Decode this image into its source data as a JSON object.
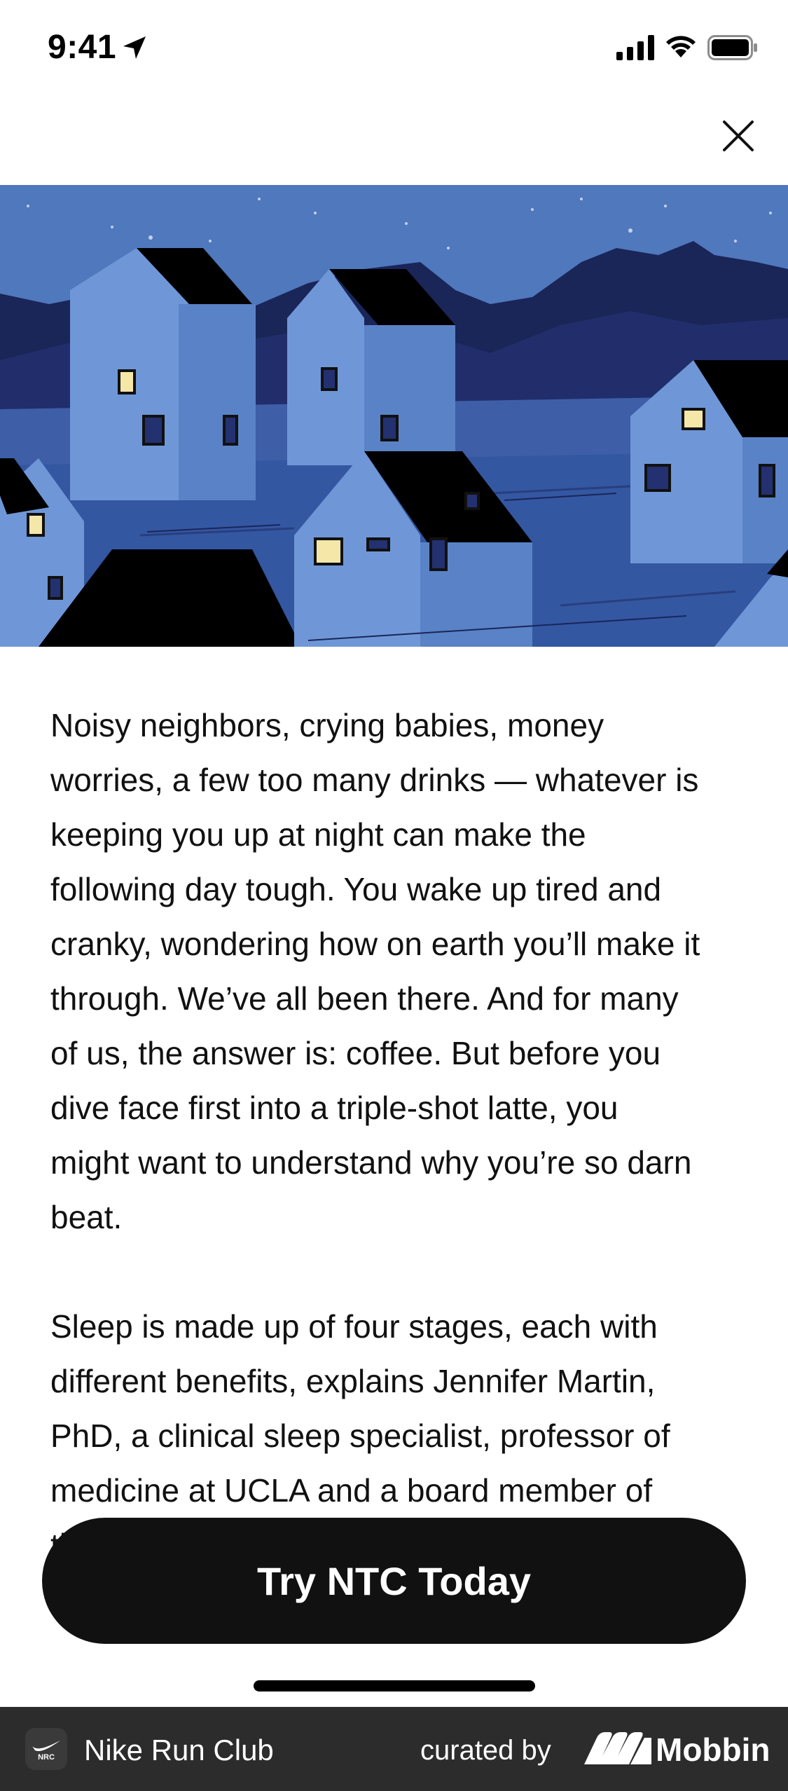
{
  "status_bar": {
    "time": "9:41",
    "icons": [
      "location-arrow-icon",
      "cellular-signal-icon",
      "wifi-icon",
      "battery-icon"
    ]
  },
  "header": {
    "close_icon": "close-icon"
  },
  "hero": {
    "illustration": "night-village-illustration",
    "colors": {
      "sky": "#4f78bd",
      "mountains": "#15204a",
      "house_light": "#6f97d8",
      "roof": "#000000",
      "window_lit": "#f4e7a8"
    }
  },
  "article": {
    "paragraphs": [
      "Noisy neighbors, crying babies, money worries, a few too many drinks — whatever is keeping you up at night can make the following day tough. You wake up tired and cranky, wondering how on earth you’ll make it through. We’ve all been there. And for many of us, the answer is: coffee. But before you dive face first into a triple-shot latte, you might want to understand why you’re so darn beat.",
      "Sleep is made up of four stages, each with different benefits, explains Jennifer Martin, PhD, a clinical sleep specialist, professor of medicine at UCLA and a board member of the American Academy of Sleep Medicine."
    ]
  },
  "cta": {
    "label": "Try NTC Today",
    "color": "#111111"
  },
  "footer": {
    "app_name": "Nike Run Club",
    "app_logo_text": "NRC",
    "curated_by": "curated by",
    "brand": "Mobbin",
    "background": "#2c2c2c"
  }
}
